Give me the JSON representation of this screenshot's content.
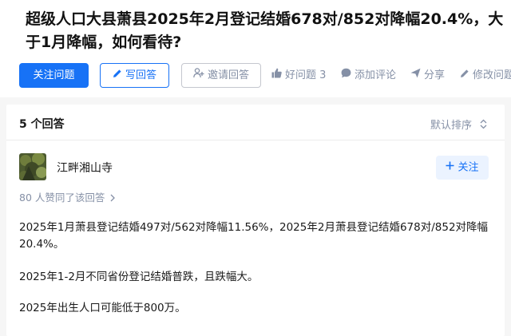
{
  "question": {
    "title": "超级人口大县萧县2025年2月登记结婚678对/852对降幅20.4%，大于1月降幅，如何看待?"
  },
  "actions": {
    "follow_label": "关注问题",
    "write_label": "写回答",
    "invite_label": "邀请回答",
    "good_question_label": "好问题 3",
    "comment_label": "添加评论",
    "share_label": "分享",
    "edit_label": "修改问题"
  },
  "answers": {
    "count_label": "5 个回答",
    "sort_label": "默认排序",
    "first": {
      "author": "江畔湘山寺",
      "follow_label": "关注",
      "votes_label": "80 人赞同了该回答",
      "paragraphs": [
        "2025年1月萧县登记结婚497对/562对降幅11.56%，2025年2月萧县登记结婚678对/852对降幅20.4%。",
        "2025年1-2月不同省份登记结婚普跌，且跌幅大。",
        "2025年出生人口可能低于800万。"
      ]
    }
  },
  "colors": {
    "accent": "#1772f6",
    "muted": "#8590a6",
    "accent_light": "#ebf3ff"
  }
}
